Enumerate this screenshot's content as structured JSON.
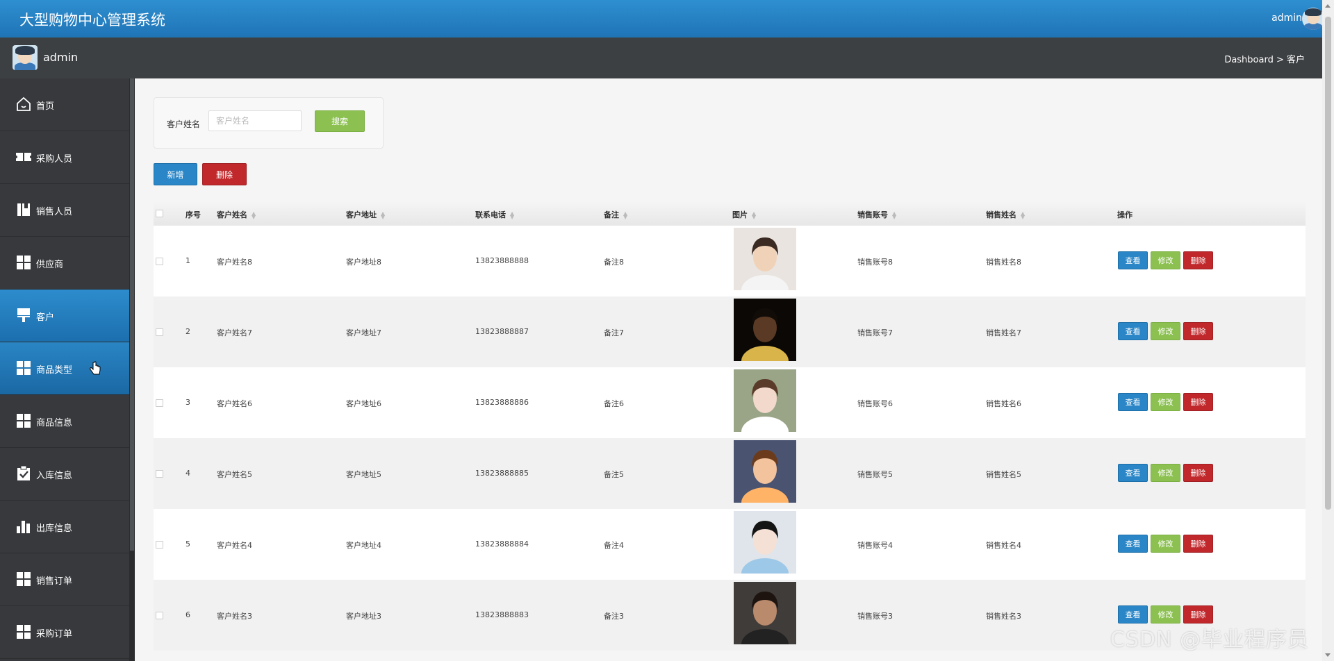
{
  "header": {
    "title": "大型购物中心管理系统",
    "user": "admin"
  },
  "subbar": {
    "name": "admin",
    "breadcrumb": "Dashboard > 客户"
  },
  "sidebar": {
    "items": [
      {
        "label": "首页",
        "icon": "home-icon"
      },
      {
        "label": "采购人员",
        "icon": "ticket-icon"
      },
      {
        "label": "销售人员",
        "icon": "book-icon"
      },
      {
        "label": "供应商",
        "icon": "grid-icon"
      },
      {
        "label": "客户",
        "icon": "brush-icon",
        "active": true
      },
      {
        "label": "商品类型",
        "icon": "grid-icon",
        "hover": true
      },
      {
        "label": "商品信息",
        "icon": "grid-icon"
      },
      {
        "label": "入库信息",
        "icon": "clipboard-icon"
      },
      {
        "label": "出库信息",
        "icon": "bar-chart-icon"
      },
      {
        "label": "销售订单",
        "icon": "grid-icon"
      },
      {
        "label": "采购订单",
        "icon": "grid-icon"
      }
    ]
  },
  "search": {
    "label": "客户姓名",
    "placeholder": "客户姓名",
    "button": "搜索"
  },
  "toolbar": {
    "new_label": "新增",
    "delete_label": "删除"
  },
  "table": {
    "columns": [
      "序号",
      "客户姓名",
      "客户地址",
      "联系电话",
      "备注",
      "图片",
      "销售账号",
      "销售姓名",
      "操作"
    ],
    "rows": [
      {
        "no": "1",
        "name": "客户姓名8",
        "address": "客户地址8",
        "phone": "13823888888",
        "note": "备注8",
        "account": "销售账号8",
        "seller": "销售姓名8"
      },
      {
        "no": "2",
        "name": "客户姓名7",
        "address": "客户地址7",
        "phone": "13823888887",
        "note": "备注7",
        "account": "销售账号7",
        "seller": "销售姓名7"
      },
      {
        "no": "3",
        "name": "客户姓名6",
        "address": "客户地址6",
        "phone": "13823888886",
        "note": "备注6",
        "account": "销售账号6",
        "seller": "销售姓名6"
      },
      {
        "no": "4",
        "name": "客户姓名5",
        "address": "客户地址5",
        "phone": "13823888885",
        "note": "备注5",
        "account": "销售账号5",
        "seller": "销售姓名5"
      },
      {
        "no": "5",
        "name": "客户姓名4",
        "address": "客户地址4",
        "phone": "13823888884",
        "note": "备注4",
        "account": "销售账号4",
        "seller": "销售姓名4"
      },
      {
        "no": "6",
        "name": "客户姓名3",
        "address": "客户地址3",
        "phone": "13823888883",
        "note": "备注3",
        "account": "销售账号3",
        "seller": "销售姓名3"
      }
    ],
    "actions": {
      "view": "查看",
      "edit": "修改",
      "delete": "删除"
    }
  },
  "watermark": "CSDN @毕业程序员"
}
